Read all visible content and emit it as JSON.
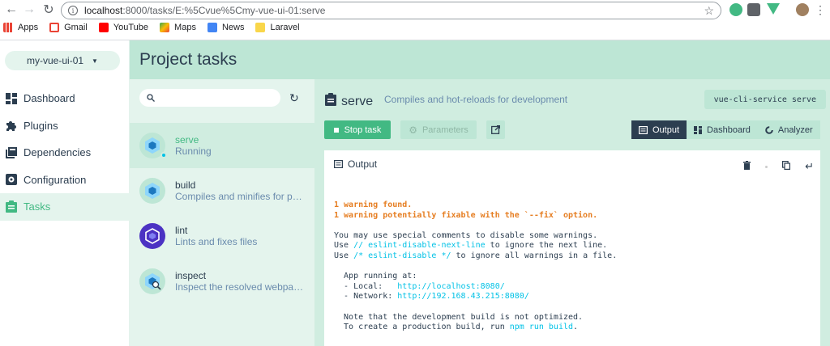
{
  "browser": {
    "url_host": "localhost",
    "url_path": ":8000/tasks/E:%5Cvue%5Cmy-vue-ui-01:serve",
    "bookmarks": [
      {
        "label": "Apps",
        "icon": "apps-grid-icon"
      },
      {
        "label": "Gmail",
        "icon": "gmail-icon"
      },
      {
        "label": "YouTube",
        "icon": "youtube-icon"
      },
      {
        "label": "Maps",
        "icon": "maps-icon"
      },
      {
        "label": "News",
        "icon": "news-icon"
      },
      {
        "label": "Laravel",
        "icon": "folder-icon"
      }
    ]
  },
  "sidebar": {
    "project": "my-vue-ui-01",
    "items": [
      {
        "label": "Dashboard",
        "icon": "dashboard-icon"
      },
      {
        "label": "Plugins",
        "icon": "puzzle-icon"
      },
      {
        "label": "Dependencies",
        "icon": "library-icon"
      },
      {
        "label": "Configuration",
        "icon": "settings-icon"
      },
      {
        "label": "Tasks",
        "icon": "clipboard-icon"
      }
    ]
  },
  "header": {
    "title": "Project tasks"
  },
  "tasks": [
    {
      "name": "serve",
      "desc": "Running"
    },
    {
      "name": "build",
      "desc": "Compiles and minifies for production"
    },
    {
      "name": "lint",
      "desc": "Lints and fixes files"
    },
    {
      "name": "inspect",
      "desc": "Inspect the resolved webpack config"
    }
  ],
  "details": {
    "name": "serve",
    "desc": "Compiles and hot-reloads for development",
    "command": "vue-cli-service serve",
    "stop_label": "Stop task",
    "params_label": "Parameters",
    "tabs": [
      "Output",
      "Dashboard",
      "Analyzer"
    ],
    "output_title": "Output"
  },
  "console": {
    "warn1": "1 warning found.",
    "warn2": "1 warning potentially fixable with the `--fix` option.",
    "l1": "You may use special comments to disable some warnings.",
    "l2a": "Use ",
    "l2b": "// eslint-disable-next-line",
    "l2c": " to ignore the next line.",
    "l3a": "Use ",
    "l3b": "/* eslint-disable */",
    "l3c": " to ignore all warnings in a file.",
    "l4": "  App running at:",
    "l5a": "  - Local:   ",
    "l5b": "http://localhost:8080/",
    "l6a": "  - Network: ",
    "l6b": "http://192.168.43.215:8080/",
    "l7": "  Note that the development build is not optimized.",
    "l8a": "  To create a production build, run ",
    "l8b": "npm run build",
    "l8c": "."
  }
}
